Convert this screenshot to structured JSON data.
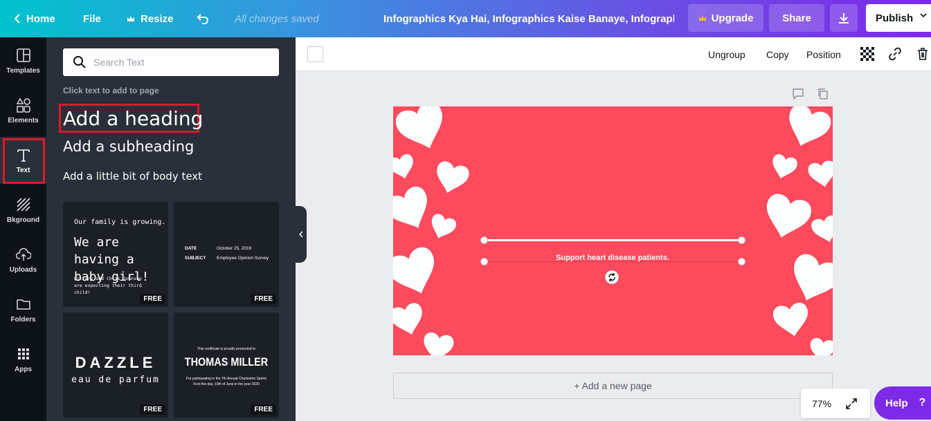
{
  "topbar": {
    "home": "Home",
    "file": "File",
    "resize": "Resize",
    "saved_status": "All changes saved",
    "title": "Infographics Kya Hai, Infographics Kaise Banaye, Infographi...",
    "upgrade": "Upgrade",
    "share": "Share",
    "publish": "Publish"
  },
  "rail": {
    "items": [
      {
        "label": "Templates",
        "icon": "templates-icon"
      },
      {
        "label": "Elements",
        "icon": "elements-icon"
      },
      {
        "label": "Text",
        "icon": "text-icon"
      },
      {
        "label": "Bkground",
        "icon": "background-icon"
      },
      {
        "label": "Uploads",
        "icon": "uploads-icon"
      },
      {
        "label": "Folders",
        "icon": "folders-icon"
      },
      {
        "label": "Apps",
        "icon": "apps-icon"
      }
    ]
  },
  "panel": {
    "search_placeholder": "Search Text",
    "hint": "Click text to add to page",
    "add_heading": "Add a heading",
    "add_subheading": "Add a subheading",
    "add_body": "Add a little bit of body text",
    "free_label": "FREE",
    "templates": {
      "t1": {
        "line1": "Our family is growing.",
        "line2": "We are having a baby girl!",
        "line3": "Hillary and Chris Johnson are expecting their third child!"
      },
      "t2": {
        "date_key": "DATE",
        "date_val": "October 25, 2019",
        "subject_key": "SUBJECT",
        "subject_val": "Employee Opinion Survey"
      },
      "t3": {
        "line1": "DAZZLE",
        "line2": "eau de parfum"
      },
      "t4": {
        "line1": "This certificate is proudly presented to",
        "line2": "THOMAS MILLER",
        "line3": "For participating in the 7th Annual Charleston Sports Fest this day, 10th of June in the year 2020"
      }
    }
  },
  "canvas_toolbar": {
    "ungroup": "Ungroup",
    "copy": "Copy",
    "position": "Position"
  },
  "design": {
    "caption": "Support heart disease patients.",
    "background_color": "#fd4a5c"
  },
  "add_page": "+ Add a new page",
  "zoom": "77%",
  "help": "Help",
  "help_mark": "?"
}
